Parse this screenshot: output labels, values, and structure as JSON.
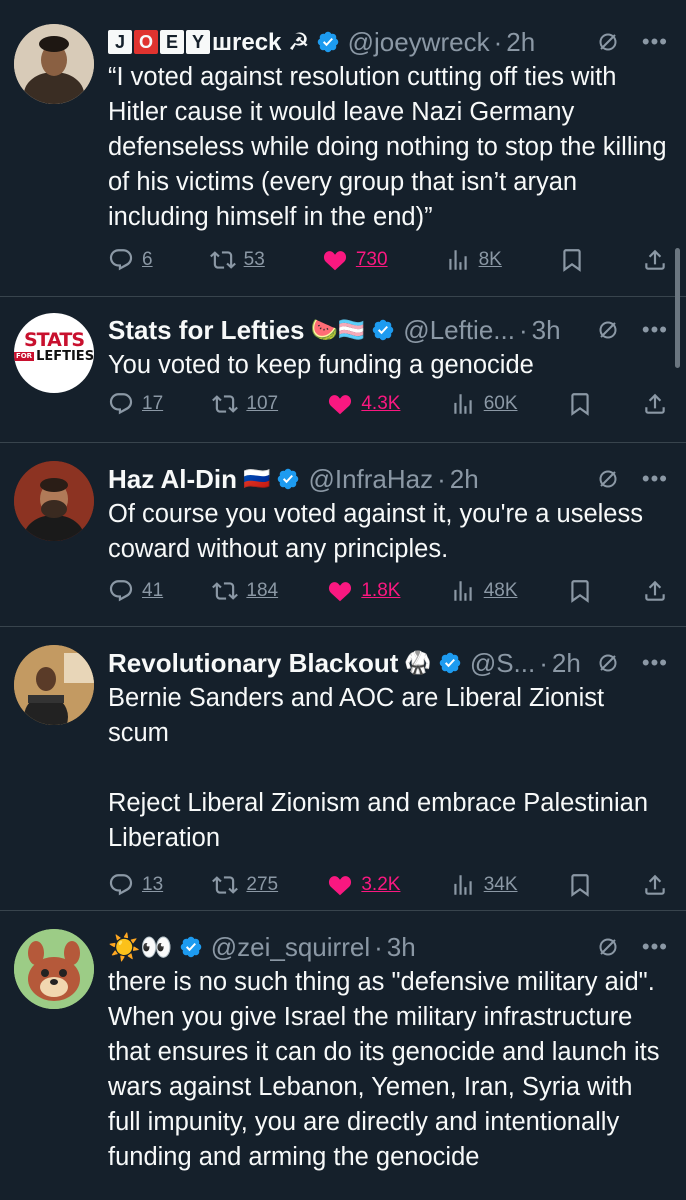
{
  "colors": {
    "background": "#15202b",
    "text": "#f7f9f9",
    "muted": "#8b98a5",
    "like": "#f91880",
    "verified": "#1d9bf0",
    "divider": "#38444d"
  },
  "tweets": [
    {
      "name_letters": [
        "J",
        "O",
        "E",
        "Y"
      ],
      "name_suffix": "шreck ☭",
      "handle": "@joeywreck",
      "time": "2h",
      "text": "“I voted against resolution cutting off ties with Hitler cause it would leave Nazi Germany defenseless while doing nothing to stop the killing of his victims (every group that isn’t aryan including himself in the end)”",
      "replies": "6",
      "reposts": "53",
      "likes": "730",
      "views": "8K"
    },
    {
      "name": "Stats for Lefties",
      "emoji": "🍉🏳️‍⚧️",
      "handle": "@Leftie...",
      "time": "3h",
      "avatar_text": {
        "top": "STATS",
        "mid": "FOR",
        "bottom": "LEFTIES"
      },
      "text": "You voted to keep funding a genocide",
      "replies": "17",
      "reposts": "107",
      "likes": "4.3K",
      "views": "60K"
    },
    {
      "name": "Haz Al-Din",
      "emoji": "🇷🇺",
      "handle": "@InfraHaz",
      "time": "2h",
      "text": "Of course you voted against it, you're a useless coward without any principles.",
      "replies": "41",
      "reposts": "184",
      "likes": "1.8K",
      "views": "48K"
    },
    {
      "name": "Revolutionary Blackout",
      "emoji": "🥋",
      "handle": "@S...",
      "time": "2h",
      "text": "Bernie Sanders and AOC are Liberal Zionist scum\n\nReject Liberal Zionism and embrace Palestinian Liberation",
      "replies": "13",
      "reposts": "275",
      "likes": "3.2K",
      "views": "34K"
    },
    {
      "name": "☀️👀",
      "handle": "@zei_squirrel",
      "time": "3h",
      "text": "there is no such thing as \"defensive military aid\". When you give Israel the military infrastructure that ensures it can do its genocide and launch its wars against Lebanon, Yemen, Iran, Syria with full impunity, you are directly and intentionally funding and arming the genocide"
    }
  ],
  "separator": "·"
}
